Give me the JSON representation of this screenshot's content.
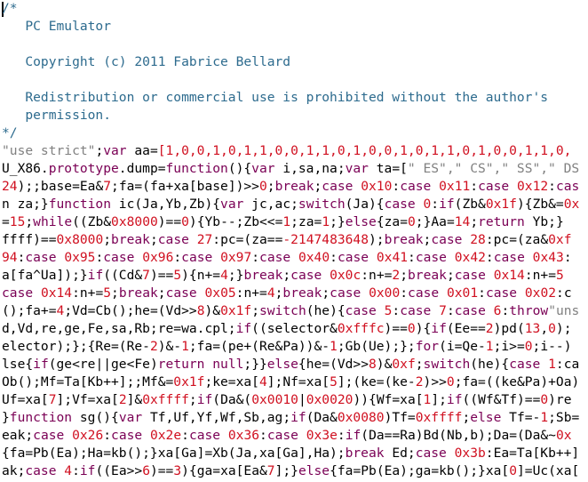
{
  "editor": {
    "colors": {
      "comment": "#2d6b8e",
      "string": "#808080",
      "keyword": "#7a0055",
      "number": "#d01020",
      "plain": "#000000",
      "background": "#ffffff"
    },
    "lines": [
      [
        [
          "c",
          "/*"
        ]
      ],
      [
        [
          "c",
          "   PC Emulator"
        ]
      ],
      [
        [
          "c",
          ""
        ]
      ],
      [
        [
          "c",
          "   Copyright (c) 2011 Fabrice Bellard"
        ]
      ],
      [
        [
          "c",
          ""
        ]
      ],
      [
        [
          "c",
          "   Redistribution or commercial use is prohibited without the author's"
        ]
      ],
      [
        [
          "c",
          "   permission."
        ]
      ],
      [
        [
          "c",
          "*/"
        ]
      ],
      [
        [
          "s",
          "\"use strict\""
        ],
        [
          "p",
          ";"
        ],
        [
          "k",
          "var"
        ],
        [
          "p",
          " aa="
        ],
        [
          "n",
          "[1,0,0,1,0,1,1,0,0,1,1,0,1,0,0,1,0,1,1,0,1,0,0,1,1,0,"
        ]
      ],
      [
        [
          "p",
          "U_X86."
        ],
        [
          "k",
          "prototype"
        ],
        [
          "p",
          ".dump="
        ],
        [
          "k",
          "function"
        ],
        [
          "p",
          "(){"
        ],
        [
          "k",
          "var"
        ],
        [
          "p",
          " i,sa,na;"
        ],
        [
          "k",
          "var"
        ],
        [
          "p",
          " ta=["
        ],
        [
          "s",
          "\" ES\",\" CS\",\" SS\",\" DS"
        ]
      ],
      [
        [
          "n",
          "24"
        ],
        [
          "p",
          ");;base=Ea&"
        ],
        [
          "n",
          "7"
        ],
        [
          "p",
          ";fa=(fa+xa[base])>>"
        ],
        [
          "n",
          "0"
        ],
        [
          "p",
          ";"
        ],
        [
          "k",
          "break"
        ],
        [
          "p",
          ";"
        ],
        [
          "k",
          "case"
        ],
        [
          "n",
          " 0x10"
        ],
        [
          "p",
          ":"
        ],
        [
          "k",
          "case"
        ],
        [
          "n",
          " 0x11"
        ],
        [
          "p",
          ":"
        ],
        [
          "k",
          "case"
        ],
        [
          "n",
          " 0x12"
        ],
        [
          "p",
          ":"
        ],
        [
          "k",
          "cas"
        ]
      ],
      [
        [
          "p",
          "n za;}"
        ],
        [
          "k",
          "function"
        ],
        [
          "p",
          " ic(Ja,Yb,Zb){"
        ],
        [
          "k",
          "var"
        ],
        [
          "p",
          " jc,ac;"
        ],
        [
          "k",
          "switch"
        ],
        [
          "p",
          "(Ja){"
        ],
        [
          "k",
          "case"
        ],
        [
          "n",
          " 0"
        ],
        [
          "p",
          ":"
        ],
        [
          "k",
          "if"
        ],
        [
          "p",
          "(Zb&"
        ],
        [
          "n",
          "0x1f"
        ],
        [
          "p",
          "){Zb&="
        ],
        [
          "n",
          "0x"
        ]
      ],
      [
        [
          "p",
          "="
        ],
        [
          "n",
          "15"
        ],
        [
          "p",
          ";"
        ],
        [
          "k",
          "while"
        ],
        [
          "p",
          "((Zb&"
        ],
        [
          "n",
          "0x8000"
        ],
        [
          "p",
          ")=="
        ],
        [
          "n",
          "0"
        ],
        [
          "p",
          "){Yb--;Zb<<="
        ],
        [
          "n",
          "1"
        ],
        [
          "p",
          ";za="
        ],
        [
          "n",
          "1"
        ],
        [
          "p",
          ";}"
        ],
        [
          "k",
          "else"
        ],
        [
          "p",
          "{za="
        ],
        [
          "n",
          "0"
        ],
        [
          "p",
          ";}Aa="
        ],
        [
          "n",
          "14"
        ],
        [
          "p",
          ";"
        ],
        [
          "k",
          "return"
        ],
        [
          "p",
          " Yb;}"
        ]
      ],
      [
        [
          "p",
          "ffff)=="
        ],
        [
          "n",
          "0x8000"
        ],
        [
          "p",
          ";"
        ],
        [
          "k",
          "break"
        ],
        [
          "p",
          ";"
        ],
        [
          "k",
          "case"
        ],
        [
          "n",
          " 27"
        ],
        [
          "p",
          ":pc=(za=="
        ],
        [
          "n",
          "-2147483648"
        ],
        [
          "p",
          ");"
        ],
        [
          "k",
          "break"
        ],
        [
          "p",
          ";"
        ],
        [
          "k",
          "case"
        ],
        [
          "n",
          " 28"
        ],
        [
          "p",
          ":pc=(za&"
        ],
        [
          "n",
          "0xf"
        ]
      ],
      [
        [
          "n",
          "94"
        ],
        [
          "p",
          ":"
        ],
        [
          "k",
          "case"
        ],
        [
          "n",
          " 0x95"
        ],
        [
          "p",
          ":"
        ],
        [
          "k",
          "case"
        ],
        [
          "n",
          " 0x96"
        ],
        [
          "p",
          ":"
        ],
        [
          "k",
          "case"
        ],
        [
          "n",
          " 0x97"
        ],
        [
          "p",
          ":"
        ],
        [
          "k",
          "case"
        ],
        [
          "n",
          " 0x40"
        ],
        [
          "p",
          ":"
        ],
        [
          "k",
          "case"
        ],
        [
          "n",
          " 0x41"
        ],
        [
          "p",
          ":"
        ],
        [
          "k",
          "case"
        ],
        [
          "n",
          " 0x42"
        ],
        [
          "p",
          ":"
        ],
        [
          "k",
          "case"
        ],
        [
          "n",
          " 0x43"
        ],
        [
          "p",
          ":"
        ]
      ],
      [
        [
          "p",
          "a[fa^Ua]);}"
        ],
        [
          "k",
          "if"
        ],
        [
          "p",
          "((Cd&"
        ],
        [
          "n",
          "7"
        ],
        [
          "p",
          ")=="
        ],
        [
          "n",
          "5"
        ],
        [
          "p",
          "){n+="
        ],
        [
          "n",
          "4"
        ],
        [
          "p",
          ";}"
        ],
        [
          "k",
          "break"
        ],
        [
          "p",
          ";"
        ],
        [
          "k",
          "case"
        ],
        [
          "n",
          " 0x0c"
        ],
        [
          "p",
          ":n+="
        ],
        [
          "n",
          "2"
        ],
        [
          "p",
          ";"
        ],
        [
          "k",
          "break"
        ],
        [
          "p",
          ";"
        ],
        [
          "k",
          "case"
        ],
        [
          "n",
          " 0x14"
        ],
        [
          "p",
          ":n+="
        ],
        [
          "n",
          "5"
        ]
      ],
      [
        [
          "k",
          "case"
        ],
        [
          "n",
          " 0x14"
        ],
        [
          "p",
          ":n+="
        ],
        [
          "n",
          "5"
        ],
        [
          "p",
          ";"
        ],
        [
          "k",
          "break"
        ],
        [
          "p",
          ";"
        ],
        [
          "k",
          "case"
        ],
        [
          "n",
          " 0x05"
        ],
        [
          "p",
          ":n+="
        ],
        [
          "n",
          "4"
        ],
        [
          "p",
          ";"
        ],
        [
          "k",
          "break"
        ],
        [
          "p",
          ";"
        ],
        [
          "k",
          "case"
        ],
        [
          "n",
          " 0x00"
        ],
        [
          "p",
          ":"
        ],
        [
          "k",
          "case"
        ],
        [
          "n",
          " 0x01"
        ],
        [
          "p",
          ":"
        ],
        [
          "k",
          "case"
        ],
        [
          "n",
          " 0x02"
        ],
        [
          "p",
          ":c"
        ]
      ],
      [
        [
          "p",
          "();fa+="
        ],
        [
          "n",
          "4"
        ],
        [
          "p",
          ";Vd=Cb();he=(Vd>>"
        ],
        [
          "n",
          "8"
        ],
        [
          "p",
          ")&"
        ],
        [
          "n",
          "0x1f"
        ],
        [
          "p",
          ";"
        ],
        [
          "k",
          "switch"
        ],
        [
          "p",
          "(he){"
        ],
        [
          "k",
          "case"
        ],
        [
          "n",
          " 5"
        ],
        [
          "p",
          ":"
        ],
        [
          "k",
          "case"
        ],
        [
          "n",
          " 7"
        ],
        [
          "p",
          ":"
        ],
        [
          "k",
          "case"
        ],
        [
          "n",
          " 6"
        ],
        [
          "p",
          ":"
        ],
        [
          "k",
          "throw"
        ],
        [
          "s",
          "\"uns"
        ]
      ],
      [
        [
          "p",
          "d,Vd,re,ge,Fe,sa,Rb;re=wa.cpl;"
        ],
        [
          "k",
          "if"
        ],
        [
          "p",
          "((selector&"
        ],
        [
          "n",
          "0xfffc"
        ],
        [
          "p",
          ")=="
        ],
        [
          "n",
          "0"
        ],
        [
          "p",
          "){"
        ],
        [
          "k",
          "if"
        ],
        [
          "p",
          "(Ee=="
        ],
        [
          "n",
          "2"
        ],
        [
          "p",
          ")pd("
        ],
        [
          "n",
          "13"
        ],
        [
          "p",
          ","
        ],
        [
          "n",
          "0"
        ],
        [
          "p",
          ");"
        ]
      ],
      [
        [
          "p",
          "elector);};{Re=(Re-"
        ],
        [
          "n",
          "2"
        ],
        [
          "p",
          ")&-"
        ],
        [
          "n",
          "1"
        ],
        [
          "p",
          ";fa=(pe+(Re&Pa))&-"
        ],
        [
          "n",
          "1"
        ],
        [
          "p",
          ";Gb(Ue);};"
        ],
        [
          "k",
          "for"
        ],
        [
          "p",
          "(i=Qe-"
        ],
        [
          "n",
          "1"
        ],
        [
          "p",
          ";i>="
        ],
        [
          "n",
          "0"
        ],
        [
          "p",
          ";i--)"
        ]
      ],
      [
        [
          "p",
          "lse{"
        ],
        [
          "k",
          "if"
        ],
        [
          "p",
          "(ge<re||ge<Fe)"
        ],
        [
          "k",
          "return null"
        ],
        [
          "p",
          ";}}"
        ],
        [
          "k",
          "else"
        ],
        [
          "p",
          "{he=(Vd>>"
        ],
        [
          "n",
          "8"
        ],
        [
          "p",
          ")&"
        ],
        [
          "n",
          "0xf"
        ],
        [
          "p",
          ";"
        ],
        [
          "k",
          "switch"
        ],
        [
          "p",
          "(he){"
        ],
        [
          "k",
          "case"
        ],
        [
          "n",
          " 1"
        ],
        [
          "p",
          ":ca"
        ]
      ],
      [
        [
          "p",
          "Ob();Mf=Ta[Kb++];;Mf&="
        ],
        [
          "n",
          "0x1f"
        ],
        [
          "p",
          ";ke=xa["
        ],
        [
          "n",
          "4"
        ],
        [
          "p",
          "];Nf=xa["
        ],
        [
          "n",
          "5"
        ],
        [
          "p",
          "];(ke=(ke-"
        ],
        [
          "n",
          "2"
        ],
        [
          "p",
          ")>>"
        ],
        [
          "n",
          "0"
        ],
        [
          "p",
          ";fa=((ke&Pa)+Oa)"
        ]
      ],
      [
        [
          "p",
          "Uf=xa["
        ],
        [
          "n",
          "7"
        ],
        [
          "p",
          "];Vf=xa["
        ],
        [
          "n",
          "2"
        ],
        [
          "p",
          "]&"
        ],
        [
          "n",
          "0xffff"
        ],
        [
          "p",
          ";"
        ],
        [
          "k",
          "if"
        ],
        [
          "p",
          "(Da&("
        ],
        [
          "n",
          "0x0010"
        ],
        [
          "p",
          "|"
        ],
        [
          "n",
          "0x0020"
        ],
        [
          "p",
          "))"
        ],
        [
          "p",
          "{Wf=xa["
        ],
        [
          "n",
          "1"
        ],
        [
          "p",
          "];"
        ],
        [
          "k",
          "if"
        ],
        [
          "p",
          "((Wf&Tf)=="
        ],
        [
          "n",
          "0"
        ],
        [
          "p",
          ")re"
        ]
      ],
      [
        [
          "p",
          "}"
        ],
        [
          "k",
          "function"
        ],
        [
          "p",
          " sg(){"
        ],
        [
          "k",
          "var"
        ],
        [
          "p",
          " Tf,Uf,Yf,Wf,Sb,ag;"
        ],
        [
          "k",
          "if"
        ],
        [
          "p",
          "(Da&"
        ],
        [
          "n",
          "0x0080"
        ],
        [
          "p",
          ")Tf="
        ],
        [
          "n",
          "0xffff"
        ],
        [
          "p",
          ";"
        ],
        [
          "k",
          "else"
        ],
        [
          "p",
          " Tf=-"
        ],
        [
          "n",
          "1"
        ],
        [
          "p",
          ";Sb="
        ]
      ],
      [
        [
          "p",
          "eak;"
        ],
        [
          "k",
          "case"
        ],
        [
          "n",
          " 0x26"
        ],
        [
          "p",
          ":"
        ],
        [
          "k",
          "case"
        ],
        [
          "n",
          " 0x2e"
        ],
        [
          "p",
          ":"
        ],
        [
          "k",
          "case"
        ],
        [
          "n",
          " 0x36"
        ],
        [
          "p",
          ":"
        ],
        [
          "k",
          "case"
        ],
        [
          "n",
          " 0x3e"
        ],
        [
          "p",
          ":"
        ],
        [
          "k",
          "if"
        ],
        [
          "p",
          "(Da==Ra)Bd(Nb,b);Da=(Da&~"
        ],
        [
          "n",
          "0x"
        ]
      ],
      [
        [
          "p",
          "{fa=Pb(Ea);Ha=kb();}xa[Ga]=Xb(Ja,xa[Ga],Ha);"
        ],
        [
          "k",
          "break"
        ],
        [
          "p",
          " Ed;"
        ],
        [
          "k",
          "case"
        ],
        [
          "n",
          " 0x3b"
        ],
        [
          "p",
          ":Ea=Ta[Kb++]"
        ]
      ],
      [
        [
          "p",
          "ak;"
        ],
        [
          "k",
          "case"
        ],
        [
          "n",
          " 4"
        ],
        [
          "p",
          ":"
        ],
        [
          "k",
          "if"
        ],
        [
          "p",
          "((Ea>>"
        ],
        [
          "n",
          "6"
        ],
        [
          "p",
          ")=="
        ],
        [
          "n",
          "3"
        ],
        [
          "p",
          "){ga=xa[Ea&"
        ],
        [
          "n",
          "7"
        ],
        [
          "p",
          "];}"
        ],
        [
          "k",
          "else"
        ],
        [
          "p",
          "{fa=Pb(Ea);ga=kb();}xa["
        ],
        [
          "n",
          "0"
        ],
        [
          "p",
          "]=Uc(xa["
        ]
      ]
    ]
  }
}
